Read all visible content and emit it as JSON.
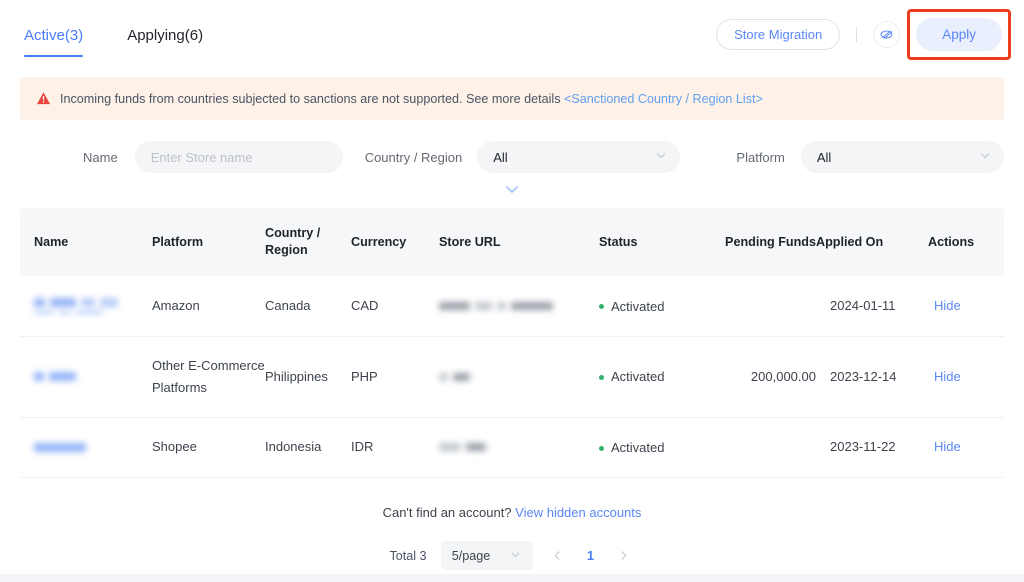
{
  "tabs": [
    {
      "label": "Active(3)",
      "active": true
    },
    {
      "label": "Applying(6)",
      "active": false
    }
  ],
  "top_actions": {
    "store_migration_label": "Store Migration",
    "hidden_icon_name": "eye-off-icon",
    "apply_label": "Apply",
    "highlight_color": "#f03c1e",
    "apply_bg": "#e9effd",
    "apply_text_color": "#5b86f8"
  },
  "banner": {
    "icon": "warning-triangle-icon",
    "text": "Incoming funds from countries subjected to sanctions are not supported. See more details ",
    "link": "<Sanctioned Country / Region List>",
    "bg": "#fdf1e8",
    "link_color": "#62a0f0"
  },
  "filters": {
    "name_label": "Name",
    "name_placeholder": "Enter Store name",
    "name_value": "",
    "country_label": "Country / Region",
    "country_value": "All",
    "platform_label": "Platform",
    "platform_value": "All",
    "expand_icon": "chevron-down-icon"
  },
  "table": {
    "columns": [
      "Name",
      "Platform",
      "Country / Region",
      "Currency",
      "Store URL",
      "Status",
      "Pending Funds",
      "Applied On",
      "Actions"
    ],
    "rows": [
      {
        "name": "",
        "platform": "Amazon",
        "country": "Canada",
        "currency": "CAD",
        "store_url": "",
        "status": "Activated",
        "pending_funds": "",
        "applied_on": "2024-01-11",
        "action": "Hide"
      },
      {
        "name": "",
        "platform": "Other E-Commerce Platforms",
        "country": "Philippines",
        "currency": "PHP",
        "store_url": "",
        "status": "Activated",
        "pending_funds": "200,000.00",
        "applied_on": "2023-12-14",
        "action": "Hide"
      },
      {
        "name": "",
        "platform": "Shopee",
        "country": "Indonesia",
        "currency": "IDR",
        "store_url": "",
        "status": "Activated",
        "pending_funds": "",
        "applied_on": "2023-11-22",
        "action": "Hide"
      }
    ],
    "status_dot_color": "#34b26c"
  },
  "footer": {
    "hint_text": "Can't find an account? ",
    "hint_link": "View hidden accounts",
    "total_label": "Total 3",
    "page_size": "5/page",
    "current_page": "1",
    "prev_icon": "chevron-left-icon",
    "next_icon": "chevron-right-icon"
  }
}
